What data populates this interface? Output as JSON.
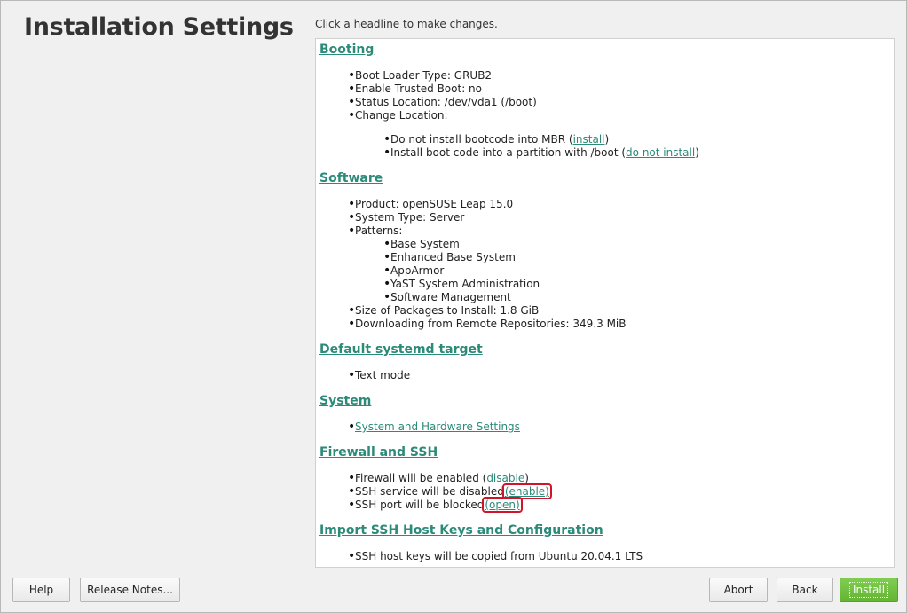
{
  "page": {
    "title": "Installation Settings",
    "instruction": "Click a headline to make changes."
  },
  "sections": {
    "booting": {
      "headline": "Booting",
      "boot_loader": "Boot Loader Type: GRUB2",
      "trusted_boot": "Enable Trusted Boot: no",
      "status_location": "Status Location: /dev/vda1 (/boot)",
      "change_location": "Change Location:",
      "mbr_text": "Do not install bootcode into MBR (",
      "mbr_link": "install",
      "mbr_close": ")",
      "partition_text": "Install boot code into a partition with /boot (",
      "partition_link": "do not install",
      "partition_close": ")"
    },
    "software": {
      "headline": "Software",
      "product": "Product: openSUSE Leap 15.0",
      "system_type": "System Type: Server",
      "patterns_label": "Patterns:",
      "patterns": [
        "Base System",
        "Enhanced Base System",
        "AppArmor",
        "YaST System Administration",
        "Software Management"
      ],
      "size": "Size of Packages to Install: 1.8 GiB",
      "downloading": "Downloading from Remote Repositories: 349.3 MiB"
    },
    "systemd": {
      "headline": "Default systemd target",
      "mode": "Text mode"
    },
    "system": {
      "headline": "System",
      "link": "System and Hardware Settings"
    },
    "firewall": {
      "headline": "Firewall and SSH",
      "fw_text": "Firewall will be enabled (",
      "fw_link": "disable",
      "fw_close": ")",
      "ssh_text": "SSH service will be disabled",
      "ssh_link": "(enable)",
      "port_text": "SSH port will be blocked",
      "port_link": "(open)"
    },
    "ssh_keys": {
      "headline": "Import SSH Host Keys and Configuration",
      "keys_text": "SSH host keys will be copied from Ubuntu 20.04.1 LTS"
    }
  },
  "buttons": {
    "help": "Help",
    "release_notes": "Release Notes...",
    "abort": "Abort",
    "back": "Back",
    "install": "Install"
  },
  "colors": {
    "link": "#2b8a78",
    "highlight": "#d0142a",
    "install_button": "#6abf3a"
  }
}
